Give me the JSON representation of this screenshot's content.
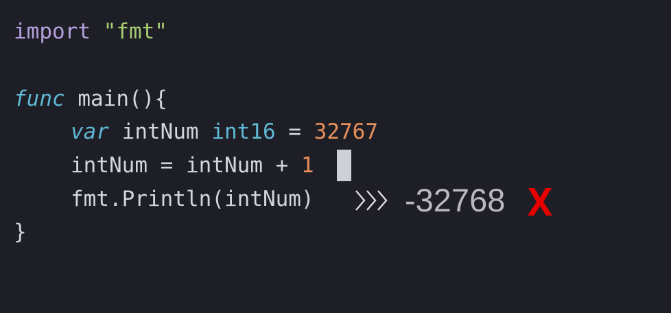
{
  "code": {
    "line1": {
      "keyword": "import",
      "string": "\"fmt\""
    },
    "line3": {
      "keyword": "func",
      "name": "main(){"
    },
    "line4": {
      "keyword": "var",
      "ident": "intNum",
      "type": "int16",
      "op": "=",
      "number": "32767"
    },
    "line5": {
      "ident": "intNum",
      "op": "=",
      "ident2": "intNum",
      "plus": "+",
      "number": "1"
    },
    "line6": {
      "call": "fmt.Println(intNum)"
    },
    "line7": {
      "brace": "}"
    }
  },
  "output": {
    "value": "-32768",
    "status_icon": "x-cross-icon",
    "status_color": "#e60000"
  },
  "colors": {
    "background": "#1e1e26",
    "keyword": "#b4a0dc",
    "string": "#a6cc70",
    "type": "#5fb8d4",
    "number": "#e8915a",
    "text": "#d4d4dc"
  }
}
